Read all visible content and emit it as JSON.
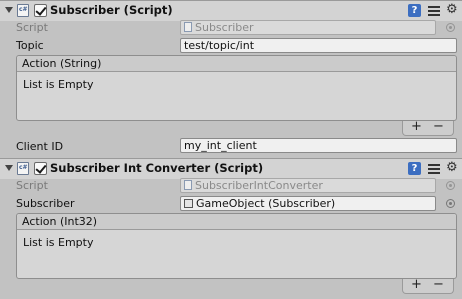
{
  "components": [
    {
      "title": "Subscriber (Script)",
      "script_label": "Script",
      "script_value": "Subscriber",
      "fields": [
        {
          "label": "Topic",
          "value": "test/topic/int"
        }
      ],
      "event": {
        "label": "Action (String)",
        "empty_text": "List is Empty",
        "add_label": "+",
        "remove_label": "−"
      },
      "after_fields": [
        {
          "label": "Client ID",
          "value": "my_int_client"
        }
      ]
    },
    {
      "title": "Subscriber Int Converter (Script)",
      "script_label": "Script",
      "script_value": "SubscriberIntConverter",
      "fields": [
        {
          "label": "Subscriber",
          "value": "GameObject (Subscriber)"
        }
      ],
      "event": {
        "label": "Action (Int32)",
        "empty_text": "List is Empty",
        "add_label": "+",
        "remove_label": "−"
      }
    }
  ],
  "icons": {
    "foldout": "foldout-arrow-icon",
    "script": "csharp-script-icon",
    "help": "help-icon",
    "preset": "preset-icon",
    "gear": "gear-icon",
    "object_picker": "object-picker-icon"
  },
  "help_glyph": "?",
  "gear_glyph": "⚙",
  "colors": {
    "background": "#c2c2c2",
    "header": "#d3d3d3",
    "help_accent": "#3c6ec1"
  }
}
